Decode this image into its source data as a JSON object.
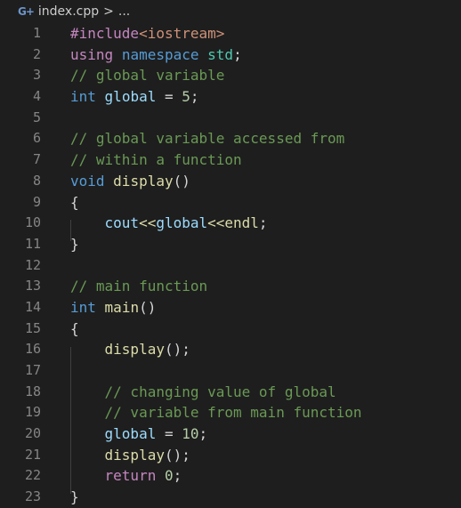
{
  "breadcrumb": {
    "icon": "G+",
    "file": "index.cpp",
    "separator": ">",
    "more": "..."
  },
  "colors": {
    "background": "#1e1e1e",
    "default": "#d4d4d4",
    "keyword": "#569cd6",
    "control": "#c586c0",
    "comment": "#6a9955",
    "function": "#dcdcaa",
    "variable": "#9cdcfe",
    "type": "#4ec9b0",
    "string": "#ce9178",
    "number": "#b5cea8",
    "line_number": "#858585"
  },
  "lines": [
    {
      "n": "1",
      "tokens": [
        {
          "t": "#include",
          "c": "control"
        },
        {
          "t": "<iostream>",
          "c": "string"
        }
      ]
    },
    {
      "n": "2",
      "tokens": [
        {
          "t": "using",
          "c": "control"
        },
        {
          "t": " ",
          "c": "default"
        },
        {
          "t": "namespace",
          "c": "keyword"
        },
        {
          "t": " ",
          "c": "default"
        },
        {
          "t": "std",
          "c": "type"
        },
        {
          "t": ";",
          "c": "default"
        }
      ]
    },
    {
      "n": "3",
      "tokens": [
        {
          "t": "// global variable",
          "c": "comment"
        }
      ]
    },
    {
      "n": "4",
      "tokens": [
        {
          "t": "int",
          "c": "keyword"
        },
        {
          "t": " ",
          "c": "default"
        },
        {
          "t": "global",
          "c": "var"
        },
        {
          "t": " = ",
          "c": "default"
        },
        {
          "t": "5",
          "c": "number"
        },
        {
          "t": ";",
          "c": "default"
        }
      ]
    },
    {
      "n": "5",
      "tokens": []
    },
    {
      "n": "6",
      "tokens": [
        {
          "t": "// global variable accessed from",
          "c": "comment"
        }
      ]
    },
    {
      "n": "7",
      "tokens": [
        {
          "t": "// within a function",
          "c": "comment"
        }
      ]
    },
    {
      "n": "8",
      "tokens": [
        {
          "t": "void",
          "c": "keyword"
        },
        {
          "t": " ",
          "c": "default"
        },
        {
          "t": "display",
          "c": "func"
        },
        {
          "t": "()",
          "c": "default"
        }
      ]
    },
    {
      "n": "9",
      "tokens": [
        {
          "t": "{",
          "c": "default"
        }
      ]
    },
    {
      "n": "10",
      "tokens": [
        {
          "t": "    ",
          "c": "default"
        },
        {
          "t": "cout",
          "c": "var"
        },
        {
          "t": "<<",
          "c": "func"
        },
        {
          "t": "global",
          "c": "var"
        },
        {
          "t": "<<",
          "c": "func"
        },
        {
          "t": "endl",
          "c": "func"
        },
        {
          "t": ";",
          "c": "default"
        }
      ]
    },
    {
      "n": "11",
      "tokens": [
        {
          "t": "}",
          "c": "default"
        }
      ]
    },
    {
      "n": "12",
      "tokens": []
    },
    {
      "n": "13",
      "tokens": [
        {
          "t": "// main function",
          "c": "comment"
        }
      ]
    },
    {
      "n": "14",
      "tokens": [
        {
          "t": "int",
          "c": "keyword"
        },
        {
          "t": " ",
          "c": "default"
        },
        {
          "t": "main",
          "c": "func"
        },
        {
          "t": "()",
          "c": "default"
        }
      ]
    },
    {
      "n": "15",
      "tokens": [
        {
          "t": "{",
          "c": "default"
        }
      ]
    },
    {
      "n": "16",
      "tokens": [
        {
          "t": "    ",
          "c": "default"
        },
        {
          "t": "display",
          "c": "func"
        },
        {
          "t": "();",
          "c": "default"
        }
      ]
    },
    {
      "n": "17",
      "tokens": []
    },
    {
      "n": "18",
      "tokens": [
        {
          "t": "    ",
          "c": "default"
        },
        {
          "t": "// changing value of global",
          "c": "comment"
        }
      ]
    },
    {
      "n": "19",
      "tokens": [
        {
          "t": "    ",
          "c": "default"
        },
        {
          "t": "// variable from main function",
          "c": "comment"
        }
      ]
    },
    {
      "n": "20",
      "tokens": [
        {
          "t": "    ",
          "c": "default"
        },
        {
          "t": "global",
          "c": "var"
        },
        {
          "t": " = ",
          "c": "default"
        },
        {
          "t": "10",
          "c": "number"
        },
        {
          "t": ";",
          "c": "default"
        }
      ]
    },
    {
      "n": "21",
      "tokens": [
        {
          "t": "    ",
          "c": "default"
        },
        {
          "t": "display",
          "c": "func"
        },
        {
          "t": "();",
          "c": "default"
        }
      ]
    },
    {
      "n": "22",
      "tokens": [
        {
          "t": "    ",
          "c": "default"
        },
        {
          "t": "return",
          "c": "control"
        },
        {
          "t": " ",
          "c": "default"
        },
        {
          "t": "0",
          "c": "number"
        },
        {
          "t": ";",
          "c": "default"
        }
      ]
    },
    {
      "n": "23",
      "tokens": [
        {
          "t": "}",
          "c": "default"
        }
      ]
    }
  ]
}
